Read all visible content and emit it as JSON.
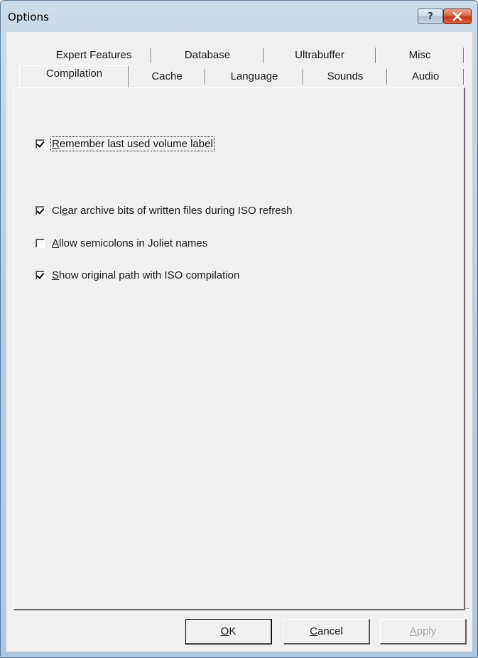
{
  "window": {
    "title": "Options",
    "help_glyph": "?",
    "close_icon": "close-x-icon"
  },
  "tabs": {
    "back_row": [
      "Expert Features",
      "Database",
      "Ultrabuffer",
      "Misc"
    ],
    "front_row": [
      "Compilation",
      "Cache",
      "Language",
      "Sounds",
      "Audio"
    ],
    "active": "Compilation"
  },
  "options": [
    {
      "mnemonic": "R",
      "rest": "emember last used volume label",
      "checked": true
    },
    {
      "pre": "Cl",
      "mnemonic": "e",
      "rest": "ar archive bits of written files during ISO refresh",
      "checked": true
    },
    {
      "mnemonic": "A",
      "rest": "llow semicolons in Joliet names",
      "checked": false
    },
    {
      "mnemonic": "S",
      "rest": "how original path with ISO compilation",
      "checked": true
    }
  ],
  "buttons": {
    "ok": {
      "mnemonic": "O",
      "rest": "K"
    },
    "cancel": {
      "mnemonic": "C",
      "rest": "ancel"
    },
    "apply": {
      "mnemonic": "A",
      "rest": "pply"
    }
  },
  "colors": {
    "frame": "#b7cde4",
    "close_button": "#c4381b",
    "face": "#f0f0f0"
  }
}
